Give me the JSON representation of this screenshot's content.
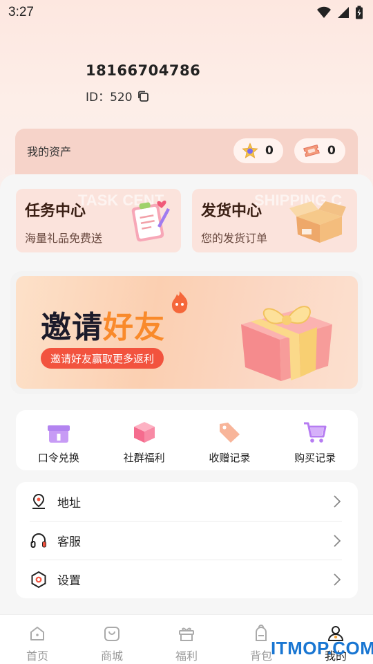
{
  "status_bar": {
    "time": "3:27"
  },
  "user": {
    "phone": "18166704786",
    "id_label": "ID：520"
  },
  "assets": {
    "label": "我的资产",
    "star_count": "0",
    "ticket_count": "0"
  },
  "features": [
    {
      "title": "任务中心",
      "subtitle": "海量礼品免费送",
      "watermark": "TASK CENT"
    },
    {
      "title": "发货中心",
      "subtitle": "您的发货订单",
      "watermark": "SHIPPING C"
    }
  ],
  "banner": {
    "title_part1": "邀请",
    "title_part2": "好友",
    "pill": "邀请好友赢取更多返利"
  },
  "quick_actions": [
    {
      "label": "口令兑换",
      "icon": "gift-box-icon"
    },
    {
      "label": "社群福利",
      "icon": "cube-box-icon"
    },
    {
      "label": "收赠记录",
      "icon": "tag-icon"
    },
    {
      "label": "购买记录",
      "icon": "cart-icon"
    }
  ],
  "menu": [
    {
      "label": "地址",
      "icon": "location-pin-icon"
    },
    {
      "label": "客服",
      "icon": "headphones-icon"
    },
    {
      "label": "设置",
      "icon": "hexagon-settings-icon"
    }
  ],
  "tabs": [
    {
      "label": "首页",
      "icon": "home-icon"
    },
    {
      "label": "商城",
      "icon": "shop-bag-icon"
    },
    {
      "label": "福利",
      "icon": "gift-icon"
    },
    {
      "label": "背包",
      "icon": "backpack-icon"
    },
    {
      "label": "我的",
      "icon": "person-icon",
      "active": true
    }
  ],
  "watermark": "ITMOP.COM",
  "colors": {
    "accent": "#f2533e",
    "highlight": "#f98a2b",
    "card_bg": "#fbe3dc"
  }
}
